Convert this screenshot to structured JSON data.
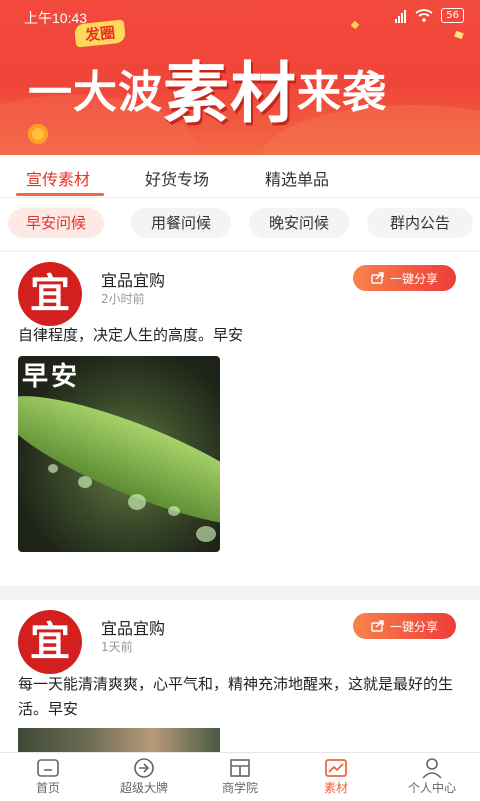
{
  "status": {
    "time": "上午10:43",
    "battery": "56"
  },
  "banner": {
    "tag": "发圈",
    "title_part1": "一大波",
    "title_part2": "素材",
    "title_part3": "来袭"
  },
  "tabs": [
    {
      "label": "宣传素材"
    },
    {
      "label": "好货专场"
    },
    {
      "label": "精选单品"
    }
  ],
  "chips": [
    {
      "label": "早安问候"
    },
    {
      "label": "用餐问候"
    },
    {
      "label": "晚安问候"
    },
    {
      "label": "群内公告"
    }
  ],
  "posts": [
    {
      "avatar": "宜",
      "name": "宜品宜购",
      "time": "2小时前",
      "share": "一键分享",
      "text": "自律程度，决定人生的高度。早安",
      "image_text": "早安"
    },
    {
      "avatar": "宜",
      "name": "宜品宜购",
      "time": "1天前",
      "share": "一键分享",
      "text": "每一天能清清爽爽，心平气和，精神充沛地醒来，这就是最好的生活。早安"
    }
  ],
  "nav": [
    {
      "label": "首页"
    },
    {
      "label": "超级大牌"
    },
    {
      "label": "商学院"
    },
    {
      "label": "素材"
    },
    {
      "label": "个人中心"
    }
  ],
  "colors": {
    "accent": "#e8322a",
    "nav_active": "#f0643a",
    "banner_red": "#f24a3c"
  }
}
